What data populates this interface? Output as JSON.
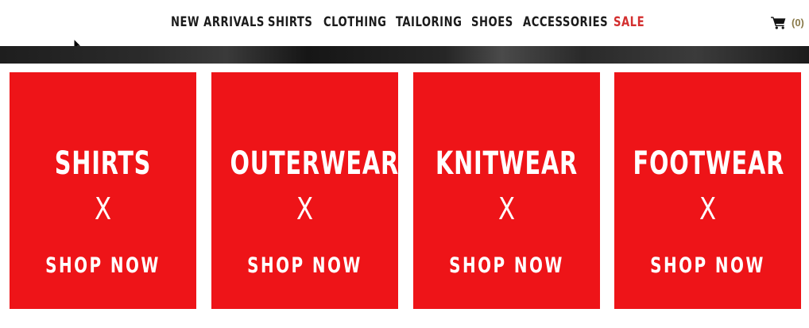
{
  "nav": {
    "items": [
      {
        "label": "NEW ARRIVALS"
      },
      {
        "label": "SHIRTS"
      },
      {
        "label": "CLOTHING"
      },
      {
        "label": "TAILORING"
      },
      {
        "label": "SHOES"
      },
      {
        "label": "ACCESSORIES"
      },
      {
        "label": "SALE"
      }
    ],
    "sale_color": "#d32f2f"
  },
  "cart": {
    "icon": "shopping-cart-icon",
    "count": "(0)"
  },
  "tiles": [
    {
      "title": "SHIRTS",
      "mark": "X",
      "cta": "SHOP NOW"
    },
    {
      "title": "OUTERWEAR",
      "mark": "X",
      "cta": "SHOP NOW"
    },
    {
      "title": "KNITWEAR",
      "mark": "X",
      "cta": "SHOP NOW"
    },
    {
      "title": "FOOTWEAR",
      "mark": "X",
      "cta": "SHOP NOW"
    }
  ],
  "colors": {
    "tile_red": "#ee1418",
    "nav_text": "#1b1b1b",
    "cart_count": "#8a7a4a"
  }
}
